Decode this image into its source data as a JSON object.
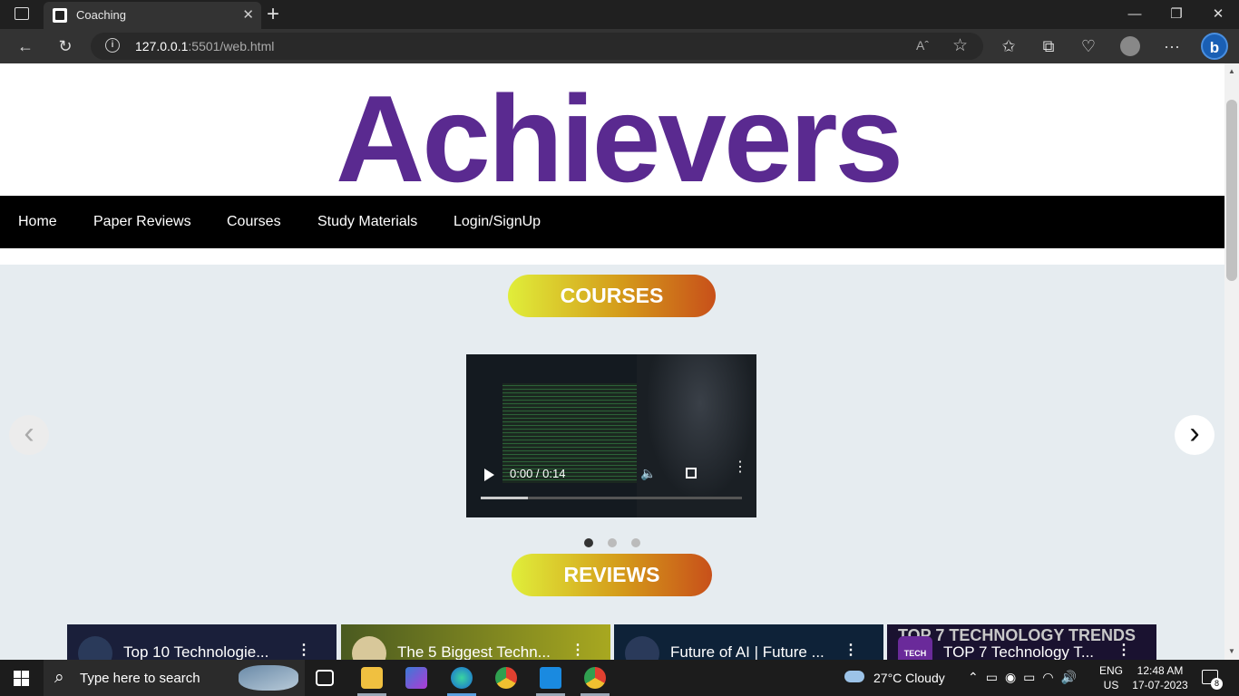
{
  "browser": {
    "tab_title": "Coaching",
    "tab_close": "✕",
    "new_tab": "+",
    "window_minimize": "—",
    "window_restore": "❐",
    "window_close": "✕",
    "back": "←",
    "reload": "↻",
    "url_host": "127.0.0.1",
    "url_rest": ":5501/web.html",
    "read_aloud": "Aˆ",
    "favorite": "☆",
    "favorites_bar": "✩",
    "collections": "⧉",
    "performance": "♡",
    "more": "···",
    "bing": "b"
  },
  "site": {
    "logo_text": "Achievers",
    "brand_color": "#5a2a90",
    "nav": [
      "Home",
      "Paper Reviews",
      "Courses",
      "Study Materials",
      "Login/SignUp"
    ],
    "courses_heading": "COURSES",
    "reviews_heading": "REVIEWS",
    "carousel": {
      "prev": "‹",
      "next": "›",
      "dots": 3,
      "active_dot": 0
    },
    "video": {
      "time": "0:00 / 0:14",
      "buffered_fraction": 0.18,
      "more": "⋮",
      "volume": "🔈"
    },
    "reviews": [
      {
        "title": "Top 10 Technologie..."
      },
      {
        "title": "The 5 Biggest Techn..."
      },
      {
        "title": "Future of AI | Future ..."
      },
      {
        "title": "TOP 7 Technology T..."
      }
    ],
    "review_thumb_banner": "TOP 7 TECHNOLOGY TRENDS",
    "review_channel_badge": "TECH"
  },
  "taskbar": {
    "search_placeholder": "Type here to search",
    "search_icon": "⌕",
    "weather": "27°C  Cloudy",
    "tray_icons": "⌃▭◉▭◠🔊",
    "lang_line1": "ENG",
    "lang_line2": "US",
    "time": "12:48 AM",
    "date": "17-07-2023",
    "notifications": "8",
    "pinned": [
      "task-view",
      "file-explorer",
      "copilot",
      "edge",
      "chrome",
      "vscode",
      "chrome-profile"
    ]
  }
}
